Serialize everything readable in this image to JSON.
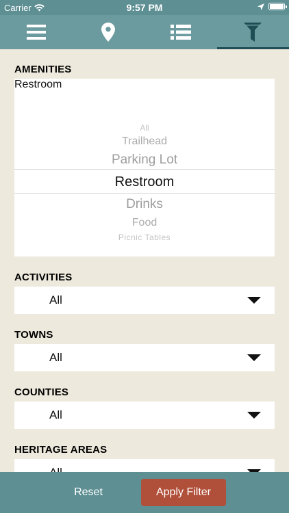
{
  "status_bar": {
    "carrier": "Carrier",
    "time": "9:57 PM"
  },
  "tabs": [
    {
      "name": "menu",
      "icon": "hamburger-menu-icon"
    },
    {
      "name": "map",
      "icon": "location-pin-icon"
    },
    {
      "name": "list",
      "icon": "bulleted-list-icon"
    },
    {
      "name": "filter",
      "icon": "funnel-filter-icon",
      "active": true
    }
  ],
  "filters": {
    "amenities": {
      "label": "AMENITIES",
      "value": "Restroom",
      "options": [
        "All",
        "Trailhead",
        "Parking Lot",
        "Restroom",
        "Drinks",
        "Food",
        "Picnic Tables"
      ]
    },
    "activities": {
      "label": "ACTIVITIES",
      "value": "All"
    },
    "towns": {
      "label": "TOWNS",
      "value": "All"
    },
    "counties": {
      "label": "COUNTIES",
      "value": "All"
    },
    "heritage_areas": {
      "label": "HERITAGE AREAS",
      "value": "All"
    }
  },
  "actions": {
    "reset_label": "Reset",
    "apply_label": "Apply Filter"
  },
  "colors": {
    "header": "#6c9b9f",
    "status_bar": "#5d8f93",
    "background": "#ede9dc",
    "apply_button": "#b1503a",
    "active_tab_indicator": "#1f4d55"
  }
}
